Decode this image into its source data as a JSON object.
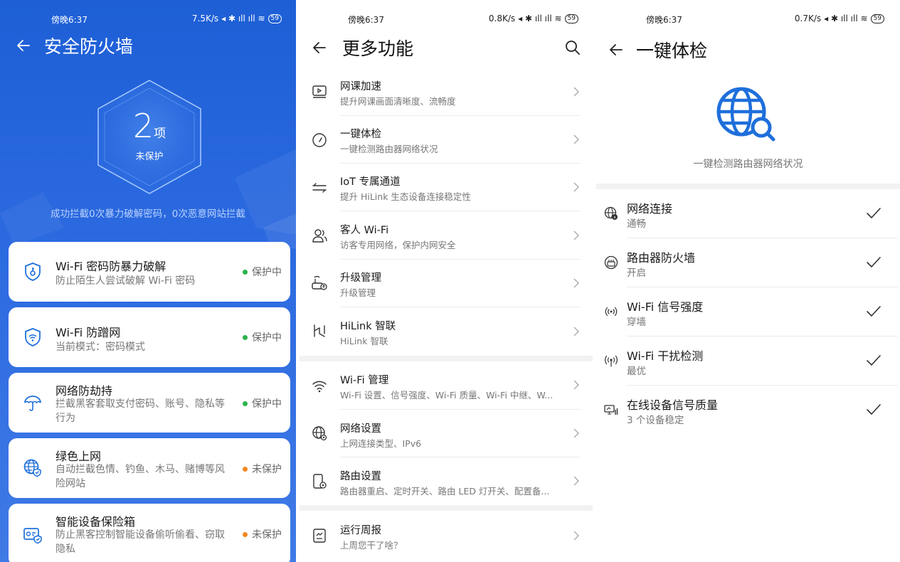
{
  "colors": {
    "brand_blue": "#2463d8",
    "icon_blue": "#1e6fdb",
    "ok_green": "#2bb34b",
    "warn_orange": "#f5871f"
  },
  "firewall": {
    "status": {
      "time": "傍晚6:37",
      "speed": "7.5K/s",
      "battery": "59"
    },
    "title": "安全防火墙",
    "count": "2",
    "count_unit": "项",
    "count_label": "未保护",
    "blocked_text": "成功拦截0次暴力破解密码，0次恶意网站拦截",
    "cards": [
      {
        "title": "Wi-Fi 密码防暴力破解",
        "desc": "防止陌生人尝试破解 Wi-Fi 密码",
        "status": "保护中",
        "icon": "shield-key-icon"
      },
      {
        "title": "Wi-Fi 防蹭网",
        "desc": "当前模式：密码模式",
        "status": "保护中",
        "icon": "shield-wifi-icon"
      },
      {
        "title": "网络防劫持",
        "desc": "拦截黑客套取支付密码、账号、隐私等行为",
        "status": "保护中",
        "icon": "umbrella-icon"
      },
      {
        "title": "绿色上网",
        "desc": "自动拦截色情、钓鱼、木马、赌博等风险网站",
        "status": "未保护",
        "icon": "globe-shield-icon"
      },
      {
        "title": "智能设备保险箱",
        "desc": "防止黑客控制智能设备偷听偷看、窃取隐私",
        "status": "未保护",
        "icon": "device-shield-icon"
      }
    ]
  },
  "more": {
    "status": {
      "time": "傍晚6:37",
      "speed": "0.8K/s",
      "battery": "59"
    },
    "title": "更多功能",
    "items": [
      {
        "title": "网课加速",
        "desc": "提升网课画面清晰度、流畅度",
        "icon": "video-icon"
      },
      {
        "title": "一键体检",
        "desc": "一键检测路由器网络状况",
        "icon": "gauge-icon"
      },
      {
        "title": "IoT 专属通道",
        "desc": "提升 HiLink 生态设备连接稳定性",
        "icon": "channel-icon"
      },
      {
        "title": "客人 Wi-Fi",
        "desc": "访客专用网络，保护内网安全",
        "icon": "guest-icon"
      },
      {
        "title": "升级管理",
        "desc": "升级管理",
        "icon": "router-upgrade-icon"
      },
      {
        "title": "HiLink 智联",
        "desc": "HiLink 智联",
        "icon": "hilink-icon"
      },
      {
        "title": "Wi-Fi 管理",
        "desc": "Wi-Fi 设置、信号强度、Wi-Fi 质量、Wi-Fi 中继、W...",
        "icon": "wifi-icon"
      },
      {
        "title": "网络设置",
        "desc": "上网连接类型、IPv6",
        "icon": "globe-gear-icon"
      },
      {
        "title": "路由设置",
        "desc": "路由器重启、定时开关、路由 LED 灯开关、配置备...",
        "icon": "router-gear-icon"
      },
      {
        "title": "运行周报",
        "desc": "上周您干了啥？",
        "icon": "report-icon"
      }
    ]
  },
  "checkup": {
    "status": {
      "time": "傍晚6:37",
      "speed": "0.7K/s",
      "battery": "59"
    },
    "title": "一键体检",
    "subtitle": "一键检测路由器网络状况",
    "items": [
      {
        "title": "网络连接",
        "desc": "通畅",
        "icon": "globe-info-icon"
      },
      {
        "title": "路由器防火墙",
        "desc": "开启",
        "icon": "firewall-icon"
      },
      {
        "title": "Wi-Fi 信号强度",
        "desc": "穿墙",
        "icon": "signal-icon"
      },
      {
        "title": "Wi-Fi 干扰检测",
        "desc": "最优",
        "icon": "interference-icon"
      },
      {
        "title": "在线设备信号质量",
        "desc": "3 个设备稳定",
        "icon": "device-signal-icon"
      }
    ]
  }
}
